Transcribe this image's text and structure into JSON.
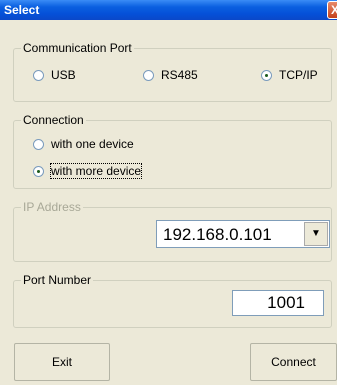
{
  "window": {
    "title": "Select",
    "close_symbol": "X"
  },
  "comm_port": {
    "legend": "Communication Port",
    "options": [
      {
        "label": "USB",
        "checked": false
      },
      {
        "label": "RS485",
        "checked": false
      },
      {
        "label": "TCP/IP",
        "checked": true
      }
    ]
  },
  "connection": {
    "legend": "Connection",
    "options": [
      {
        "label": "with one device",
        "checked": false
      },
      {
        "label": "with more device",
        "checked": true
      }
    ]
  },
  "ip": {
    "legend": "IP Address",
    "value": "192.168.0.101",
    "dropdown_icon": "dropdown-arrow-icon",
    "disabled": true
  },
  "port": {
    "legend": "Port Number",
    "value": "1001"
  },
  "buttons": {
    "exit": "Exit",
    "connect": "Connect"
  }
}
